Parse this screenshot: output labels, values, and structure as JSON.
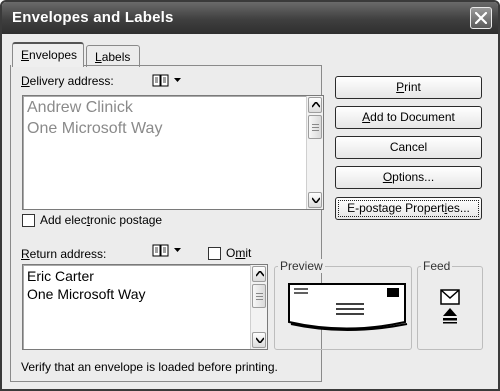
{
  "window": {
    "title": "Envelopes and Labels"
  },
  "tabs": [
    {
      "label": "Envelopes",
      "mnemonic": "E",
      "active": true
    },
    {
      "label": "Labels",
      "mnemonic": "L",
      "active": false
    }
  ],
  "delivery": {
    "label_mn": "D",
    "label_rest": "elivery address:",
    "lines": [
      "Andrew Clinick",
      "One Microsoft Way"
    ],
    "text_color": "#8a8a8a"
  },
  "postage": {
    "pre": "Add elec",
    "mn": "t",
    "post": "ronic postage",
    "checked": false
  },
  "return": {
    "label_mn": "R",
    "label_rest": "eturn address:",
    "lines": [
      "Eric Carter",
      "One Microsoft Way"
    ]
  },
  "omit": {
    "pre": "O",
    "mn": "m",
    "post": "it",
    "checked": false
  },
  "buttons": {
    "print": {
      "mn": "P",
      "rest": "rint"
    },
    "add": {
      "mn": "A",
      "rest": "dd to Document"
    },
    "cancel": "Cancel",
    "options": {
      "mn": "O",
      "rest": "ptions..."
    },
    "epostage": {
      "pre": "E-postage Propert",
      "mn": "i",
      "post": "es..."
    }
  },
  "preview": {
    "label": "Preview"
  },
  "feed": {
    "label": "Feed"
  },
  "status": "Verify that an envelope is loaded before printing.",
  "icons": {
    "close": "close-icon",
    "address_book": "address-book-icon",
    "dropdown": "chevron-down-icon",
    "envelope_preview": "envelope-preview-icon",
    "feed": "envelope-feed-icon"
  }
}
